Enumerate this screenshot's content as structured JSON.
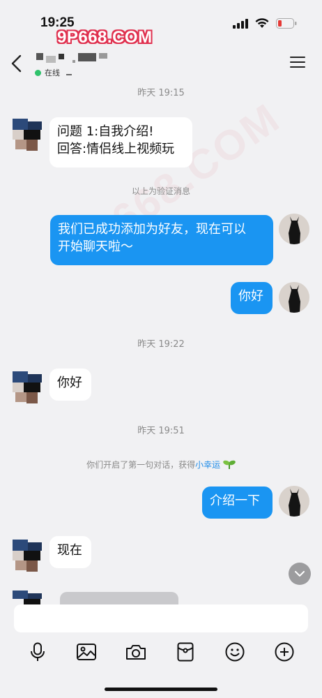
{
  "status_bar": {
    "time": "19:25",
    "watermark": "9P668.COM"
  },
  "header": {
    "online_status": "在线"
  },
  "messages": [
    {
      "side": "incoming",
      "lines": [
        "问题 1:自我介绍!",
        "回答:情侣线上视频玩"
      ]
    },
    {
      "side": "outgoing",
      "lines": [
        "我们已成功添加为好友，现在可以",
        "开始聊天啦～"
      ]
    },
    {
      "side": "outgoing",
      "lines": [
        "你好"
      ]
    },
    {
      "side": "incoming",
      "lines": [
        "你好"
      ]
    },
    {
      "side": "outgoing",
      "lines": [
        "介绍一下"
      ]
    },
    {
      "side": "incoming",
      "lines": [
        "现在"
      ]
    }
  ],
  "timestamps": [
    "昨天 19:15",
    "昨天 19:22",
    "昨天 19:51"
  ],
  "system_notes": {
    "verification": "以上为验证消息",
    "first_chat_prefix": "你们开启了第一句对话，获得",
    "first_chat_highlight": "小幸运"
  },
  "icons": [
    "back-arrow-icon",
    "menu-icon",
    "signal-icon",
    "wifi-icon",
    "battery-icon",
    "microphone-icon",
    "image-icon",
    "camera-icon",
    "red-packet-icon",
    "emoji-icon",
    "plus-icon",
    "chevron-down-icon",
    "sprout-icon"
  ],
  "colors": {
    "outgoing_bubble": "#1a95f2",
    "online_dot": "#2fc26b",
    "link": "#1f8ce8",
    "battery_low": "#e53935"
  }
}
